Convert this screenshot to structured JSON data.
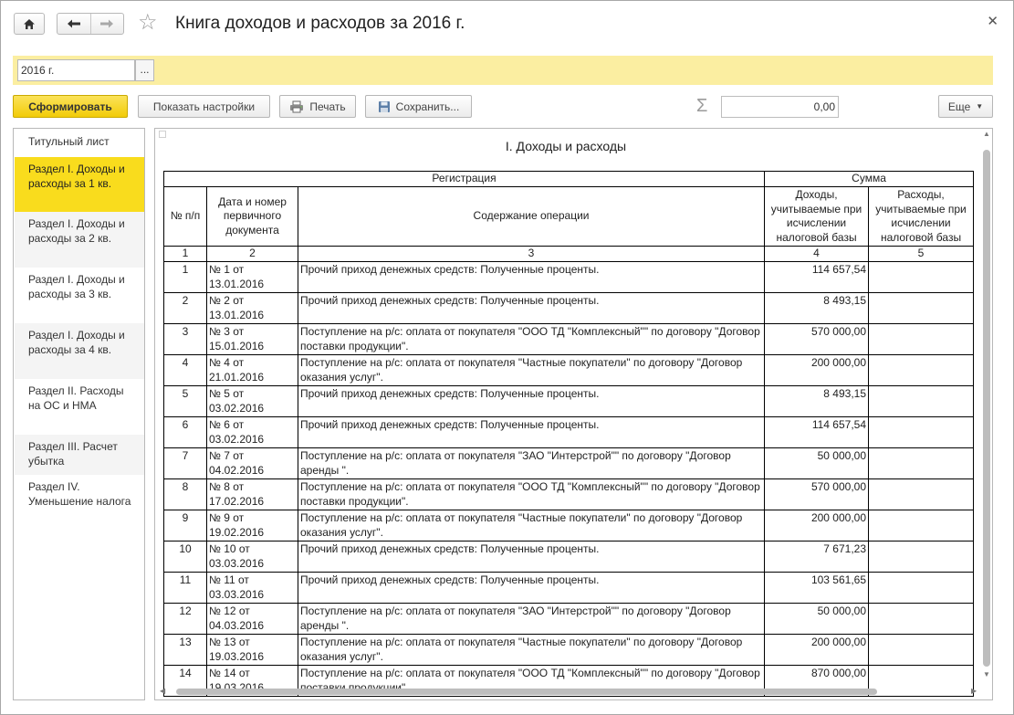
{
  "window": {
    "title": "Книга доходов и расходов за 2016 г."
  },
  "period": {
    "value": "2016 г.",
    "picker_label": "..."
  },
  "toolbar": {
    "generate_label": "Сформировать",
    "settings_label": "Показать настройки",
    "print_label": "Печать",
    "save_label": "Сохранить...",
    "sum_value": "0,00",
    "more_label": "Еще"
  },
  "nav": {
    "items": [
      {
        "label": "Титульный лист"
      },
      {
        "label": "Раздел I. Доходы и расходы за 1 кв."
      },
      {
        "label": "Раздел I. Доходы и расходы за 2 кв."
      },
      {
        "label": "Раздел I. Доходы и расходы за 3 кв."
      },
      {
        "label": "Раздел I. Доходы и расходы за 4 кв."
      },
      {
        "label": "Раздел II. Расходы на ОС и НМА"
      },
      {
        "label": "Раздел III. Расчет убытка"
      },
      {
        "label": "Раздел IV. Уменьшение налога"
      }
    ],
    "active_index": 1
  },
  "report": {
    "title": "I. Доходы и расходы",
    "header": {
      "registration": "Регистрация",
      "sum": "Сумма",
      "col_num": "№ п/п",
      "col_doc": "Дата и номер первичного документа",
      "col_content": "Содержание операции",
      "col_income": "Доходы, учитываемые при исчислении налоговой базы",
      "col_expense": "Расходы, учитываемые при исчислении налоговой базы",
      "idx": [
        "1",
        "2",
        "3",
        "4",
        "5"
      ]
    },
    "rows": [
      {
        "n": "1",
        "doc": "№ 1 от 13.01.2016",
        "content": "Прочий приход денежных средств: Полученные проценты.",
        "income": "114 657,54",
        "expense": ""
      },
      {
        "n": "2",
        "doc": "№ 2 от 13.01.2016",
        "content": "Прочий приход денежных средств: Полученные проценты.",
        "income": "8 493,15",
        "expense": ""
      },
      {
        "n": "3",
        "doc": "№ 3 от 15.01.2016",
        "content": "Поступление на р/с: оплата от покупателя \"ООО ТД \"Комплексный\"\" по договору \"Договор поставки продукции\".",
        "income": "570 000,00",
        "expense": ""
      },
      {
        "n": "4",
        "doc": "№ 4 от 21.01.2016",
        "content": "Поступление на р/с: оплата от покупателя \"Частные покупатели\" по договору \"Договор оказания услуг\".",
        "income": "200 000,00",
        "expense": ""
      },
      {
        "n": "5",
        "doc": "№ 5 от 03.02.2016",
        "content": "Прочий приход денежных средств: Полученные проценты.",
        "income": "8 493,15",
        "expense": ""
      },
      {
        "n": "6",
        "doc": "№ 6 от 03.02.2016",
        "content": "Прочий приход денежных средств: Полученные проценты.",
        "income": "114 657,54",
        "expense": ""
      },
      {
        "n": "7",
        "doc": "№ 7 от 04.02.2016",
        "content": "Поступление на р/с: оплата от покупателя \"ЗАО \"Интерстрой\"\" по договору \"Договор аренды \".",
        "income": "50 000,00",
        "expense": ""
      },
      {
        "n": "8",
        "doc": "№ 8 от 17.02.2016",
        "content": "Поступление на р/с: оплата от покупателя \"ООО ТД \"Комплексный\"\" по договору \"Договор поставки продукции\".",
        "income": "570 000,00",
        "expense": ""
      },
      {
        "n": "9",
        "doc": "№ 9 от 19.02.2016",
        "content": "Поступление на р/с: оплата от покупателя \"Частные покупатели\" по договору \"Договор оказания услуг\".",
        "income": "200 000,00",
        "expense": ""
      },
      {
        "n": "10",
        "doc": "№ 10 от 03.03.2016",
        "content": "Прочий приход денежных средств: Полученные проценты.",
        "income": "7 671,23",
        "expense": ""
      },
      {
        "n": "11",
        "doc": "№ 11 от 03.03.2016",
        "content": "Прочий приход денежных средств: Полученные проценты.",
        "income": "103 561,65",
        "expense": ""
      },
      {
        "n": "12",
        "doc": "№ 12 от 04.03.2016",
        "content": "Поступление на р/с: оплата от покупателя \"ЗАО \"Интерстрой\"\" по договору \"Договор аренды \".",
        "income": "50 000,00",
        "expense": ""
      },
      {
        "n": "13",
        "doc": "№ 13 от 19.03.2016",
        "content": "Поступление на р/с: оплата от покупателя \"Частные покупатели\" по договору \"Договор оказания услуг\".",
        "income": "200 000,00",
        "expense": ""
      },
      {
        "n": "14",
        "doc": "№ 14 от 19.03.2016",
        "content": "Поступление на р/с: оплата от покупателя \"ООО ТД \"Комплексный\"\" по договору \"Договор поставки продукции\".",
        "income": "870 000,00",
        "expense": ""
      }
    ]
  },
  "colors": {
    "accent_yellow": "#f9dc1d",
    "period_bar": "#fbeea1"
  },
  "icons": {
    "home": "home-icon",
    "back": "arrow-left-icon",
    "forward": "arrow-right-icon",
    "favorite": "star-icon",
    "close": "close-icon",
    "print": "printer-icon",
    "save": "floppy-disk-icon",
    "sigma": "sigma-icon",
    "more": "caret-down-icon"
  }
}
